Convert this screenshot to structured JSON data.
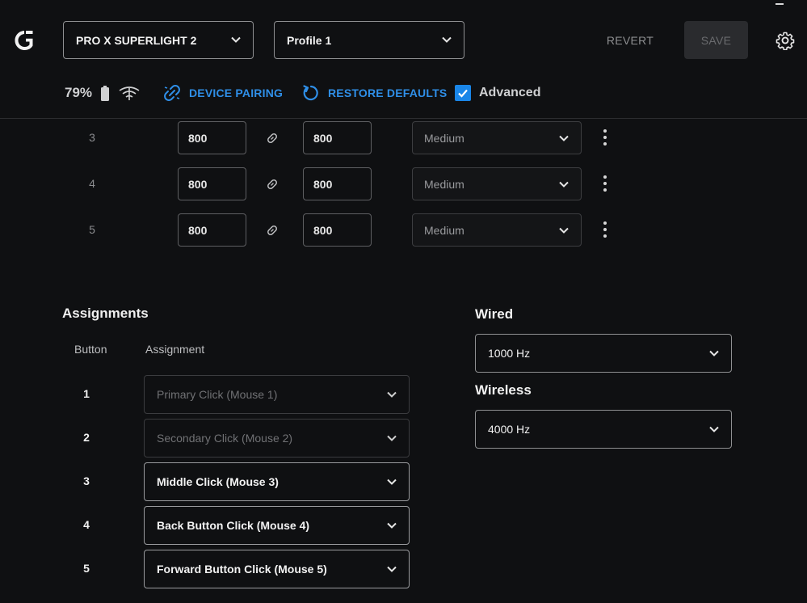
{
  "header": {
    "device_name": "PRO X SUPERLIGHT 2",
    "profile_name": "Profile 1",
    "revert_label": "REVERT",
    "save_label": "SAVE"
  },
  "status": {
    "battery_percent": "79%",
    "device_pairing_label": "DEVICE PAIRING",
    "restore_defaults_label": "RESTORE DEFAULTS",
    "advanced_label": "Advanced",
    "advanced_checked": true
  },
  "dpi_rows": [
    {
      "index": "3",
      "x": "800",
      "y": "800",
      "lift_off": "Medium"
    },
    {
      "index": "4",
      "x": "800",
      "y": "800",
      "lift_off": "Medium"
    },
    {
      "index": "5",
      "x": "800",
      "y": "800",
      "lift_off": "Medium"
    }
  ],
  "assignments": {
    "title": "Assignments",
    "col_button": "Button",
    "col_assignment": "Assignment",
    "rows": [
      {
        "button": "1",
        "assignment": "Primary Click (Mouse 1)",
        "enabled": false
      },
      {
        "button": "2",
        "assignment": "Secondary Click (Mouse 2)",
        "enabled": false
      },
      {
        "button": "3",
        "assignment": "Middle Click (Mouse 3)",
        "enabled": true
      },
      {
        "button": "4",
        "assignment": "Back Button Click (Mouse 4)",
        "enabled": true
      },
      {
        "button": "5",
        "assignment": "Forward Button Click (Mouse 5)",
        "enabled": true
      }
    ]
  },
  "report_rate": {
    "wired_label": "Wired",
    "wired_value": "1000 Hz",
    "wireless_label": "Wireless",
    "wireless_value": "4000 Hz"
  },
  "colors": {
    "background": "#0f1012",
    "accent_blue": "#2f8fe8",
    "checkbox_blue": "#1a86e8"
  },
  "icons": {
    "logo": "logitech-g-logo",
    "chevron": "chevron-down-icon",
    "settings": "gear-icon",
    "battery": "battery-icon",
    "signal": "wireless-signal-icon",
    "pairing": "broken-link-icon",
    "restore": "refresh-icon",
    "link": "link-icon",
    "more": "kebab-menu-icon"
  }
}
